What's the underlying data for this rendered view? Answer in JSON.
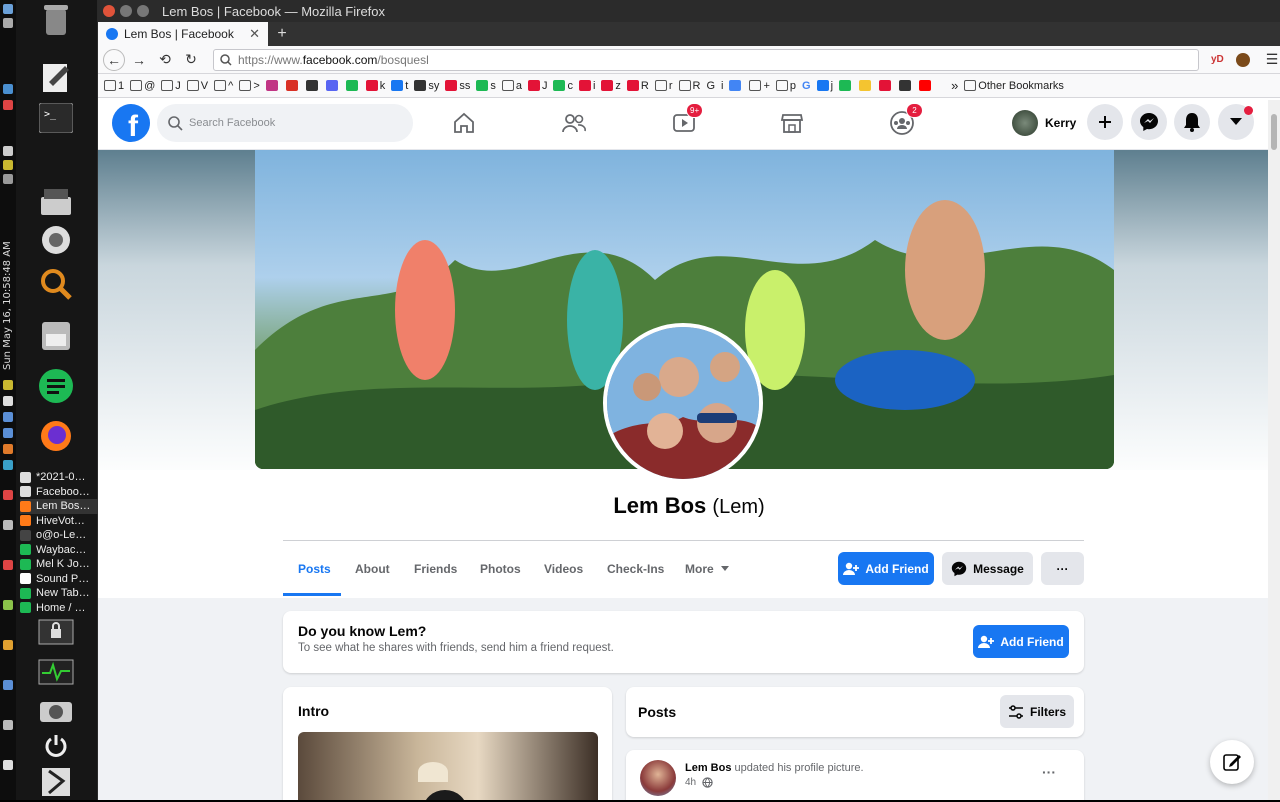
{
  "desktop": {
    "clock": "Sun May 16, 10:58:48 AM",
    "tasks": [
      "*2021-0…",
      "Faceboo…",
      "Lem Bos…",
      "HiveVot…",
      "o@o-Le…",
      "Waybac…",
      "Mel K Jo…",
      "Sound P…",
      "New Tab…",
      "Home / …"
    ]
  },
  "window": {
    "title": "Lem Bos | Facebook — Mozilla Firefox"
  },
  "browser": {
    "tab_title": "Lem Bos | Facebook",
    "url_prefix": "https://www.",
    "url_domain": "facebook.com",
    "url_path": "/bosquesl",
    "ext1": "yD",
    "bookmarks": [
      "1",
      "@",
      "J",
      "V",
      "^",
      ">",
      "",
      "",
      "",
      "",
      "",
      "k",
      "t",
      "sy",
      "ss",
      "s",
      "a",
      "J",
      "c",
      "i",
      "z",
      "R",
      "r",
      "R",
      "G",
      "i",
      "",
      "+",
      "p",
      "G",
      "j",
      "",
      "",
      "",
      "",
      ""
    ],
    "other_bookmarks": "Other Bookmarks"
  },
  "facebook": {
    "search_placeholder": "Search Facebook",
    "watch_badge": "9+",
    "groups_badge": "2",
    "user_name": "Kerry",
    "profile_name": "Lem Bos",
    "nickname": "(Lem)",
    "tabs": [
      "Posts",
      "About",
      "Friends",
      "Photos",
      "Videos",
      "Check-Ins",
      "More"
    ],
    "add_friend": "Add Friend",
    "message": "Message",
    "more_dots": "···",
    "know_title": "Do you know Lem?",
    "know_sub": "To see what he shares with friends, send him a friend request.",
    "intro_title": "Intro",
    "posts_title": "Posts",
    "filters": "Filters",
    "post_author": "Lem Bos",
    "post_action": "updated his profile picture.",
    "post_time": "4h"
  },
  "colors": {
    "fb_blue": "#1877f2",
    "badge_red": "#e41e3f"
  }
}
